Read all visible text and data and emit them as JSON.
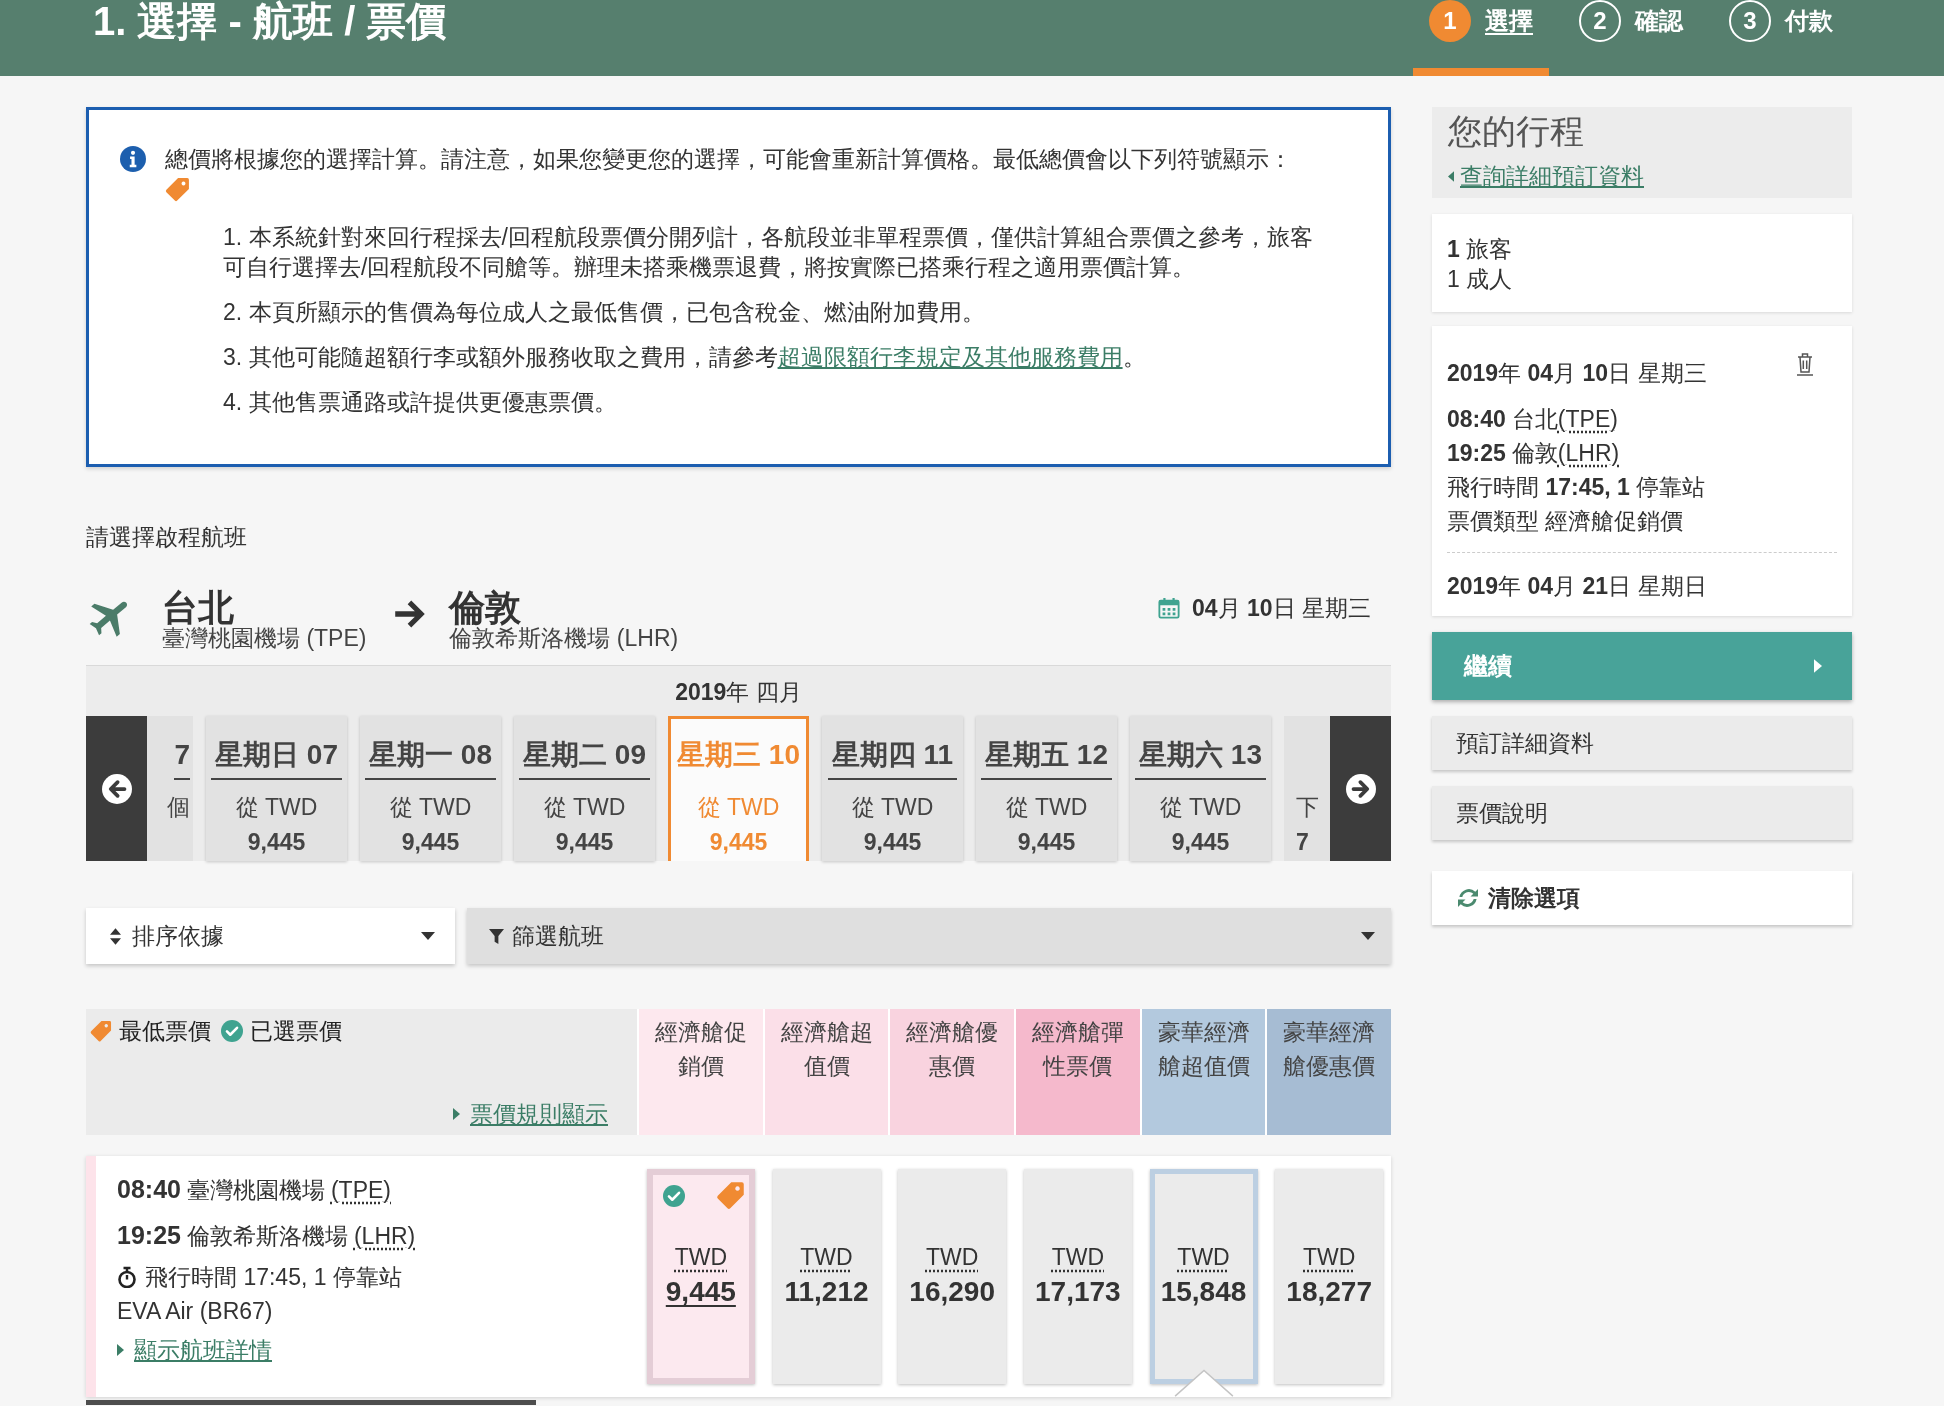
{
  "header": {
    "title": "1. 選擇 - 航班 / 票價",
    "steps": [
      {
        "number": "1",
        "label": "選擇",
        "selected": true
      },
      {
        "number": "2",
        "label": "確認",
        "selected": false
      },
      {
        "number": "3",
        "label": "付款",
        "selected": false
      }
    ]
  },
  "notice": {
    "intro": "總價將根據您的選擇計算。請注意，如果您變更您的選擇，可能會重新計算價格。最低總價會以下列符號顯示：",
    "items": [
      {
        "lines": [
          "1. 本系統針對來回行程採去/回程航段票價分開列計，各航段並非單程票價，僅供計算組合票價之參考，旅客",
          "可自行選擇去/回程航段不同艙等。辦理未搭乘機票退費，將按實際已搭乘行程之適用票價計算。"
        ]
      },
      {
        "lines": [
          "2. 本頁所顯示的售價為每位成人之最低售價，已包含稅金、燃油附加費用。"
        ]
      },
      {
        "lines": [
          "3. 其他可能隨超額行李或額外服務收取之費用，請參考"
        ],
        "link": "超過限額行李規定及其他服務費用",
        "after_link": "。"
      },
      {
        "lines": [
          "4. 其他售票通路或許提供更優惠票價。"
        ]
      }
    ]
  },
  "outbound": {
    "heading": "請選擇啟程航班",
    "origin": {
      "city": "台北",
      "airport": "臺灣桃園機場 (TPE)"
    },
    "destination": {
      "city": "倫敦",
      "airport": "倫敦希斯洛機場 (LHR)"
    },
    "date": "**04**月 **10**日 星期三",
    "month": "**2019**年 四月",
    "days": [
      {
        "kind": "partial",
        "day": "7",
        "from": "個",
        "selected": false
      },
      {
        "kind": "day",
        "day": "星期日 07",
        "from": "從 TWD",
        "price": "9,445",
        "selected": false
      },
      {
        "kind": "day",
        "day": "星期一 08",
        "from": "從 TWD",
        "price": "9,445",
        "selected": false
      },
      {
        "kind": "day",
        "day": "星期二 09",
        "from": "從 TWD",
        "price": "9,445",
        "selected": false
      },
      {
        "kind": "day",
        "day": "星期三 10",
        "from": "從 TWD",
        "price": "9,445",
        "selected": true
      },
      {
        "kind": "day",
        "day": "星期四 11",
        "from": "從 TWD",
        "price": "9,445",
        "selected": false
      },
      {
        "kind": "day",
        "day": "星期五 12",
        "from": "從 TWD",
        "price": "9,445",
        "selected": false
      },
      {
        "kind": "day",
        "day": "星期六 13",
        "from": "從 TWD",
        "price": "9,445",
        "selected": false
      },
      {
        "kind": "partial",
        "from": "下",
        "price": "7",
        "selected": false
      }
    ]
  },
  "sort": {
    "label": "排序依據"
  },
  "filter": {
    "label": "篩選航班"
  },
  "fare_table": {
    "legend": [
      {
        "kind": "lowest",
        "label": "最低票價"
      },
      {
        "kind": "selected",
        "label": "已選票價"
      }
    ],
    "rules_link": "票價規則顯示",
    "columns": [
      {
        "label": "經濟艙促銷價",
        "color": "#fde8ee"
      },
      {
        "label": "經濟艙超值價",
        "color": "#fbdfe8"
      },
      {
        "label": "經濟艙優惠價",
        "color": "#f9d3df"
      },
      {
        "label": "經濟艙彈性票價",
        "color": "#f5b9cc"
      },
      {
        "label": "豪華經濟艙超值價",
        "color": "#b3c9de"
      },
      {
        "label": "豪華經濟艙優惠價",
        "color": "#a6bcd3"
      }
    ],
    "flights": [
      {
        "departure": {
          "time": "08:40",
          "place": "臺灣桃園機場",
          "code": "(TPE)"
        },
        "arrival": {
          "time": "19:25",
          "place": "倫敦希斯洛機場",
          "code": "(LHR)"
        },
        "duration": "飛行時間 17:45, 1 停靠站",
        "carrier": "EVA Air (BR67)",
        "details_link": "顯示航班詳情",
        "fares": [
          {
            "currency": "TWD",
            "price": "9,445",
            "selected": true,
            "lowest": true,
            "expanded": false
          },
          {
            "currency": "TWD",
            "price": "11,212",
            "selected": false,
            "lowest": false,
            "expanded": false
          },
          {
            "currency": "TWD",
            "price": "16,290",
            "selected": false,
            "lowest": false,
            "expanded": false
          },
          {
            "currency": "TWD",
            "price": "17,173",
            "selected": false,
            "lowest": false,
            "expanded": false
          },
          {
            "currency": "TWD",
            "price": "15,848",
            "selected": false,
            "lowest": false,
            "expanded": true
          },
          {
            "currency": "TWD",
            "price": "18,277",
            "selected": false,
            "lowest": false,
            "expanded": false
          }
        ]
      }
    ]
  },
  "sidebar": {
    "title": "您的行程",
    "back_link": "查詢詳細預訂資料",
    "passengers": [
      "**1** 旅客",
      "1 成人"
    ],
    "trip": {
      "outbound_date": "**2019**年 **04**月 **10**日 星期三",
      "departure": {
        "time": "08:40",
        "place": "台北",
        "code": "(TPE)"
      },
      "arrival": {
        "time": "19:25",
        "place": "倫敦",
        "code": "(LHR)"
      },
      "duration": "飛行時間 **17:45, 1** 停靠站",
      "fare_type": "票價類型 經濟艙促銷價",
      "return_date": "**2019**年 **04**月 **21**日 星期日"
    },
    "buttons": [
      {
        "kind": "primary",
        "label": "繼續"
      },
      {
        "kind": "secondary",
        "label": "預訂詳細資料"
      },
      {
        "kind": "secondary",
        "label": "票價說明"
      },
      {
        "kind": "reset",
        "label": "清除選項"
      }
    ]
  }
}
